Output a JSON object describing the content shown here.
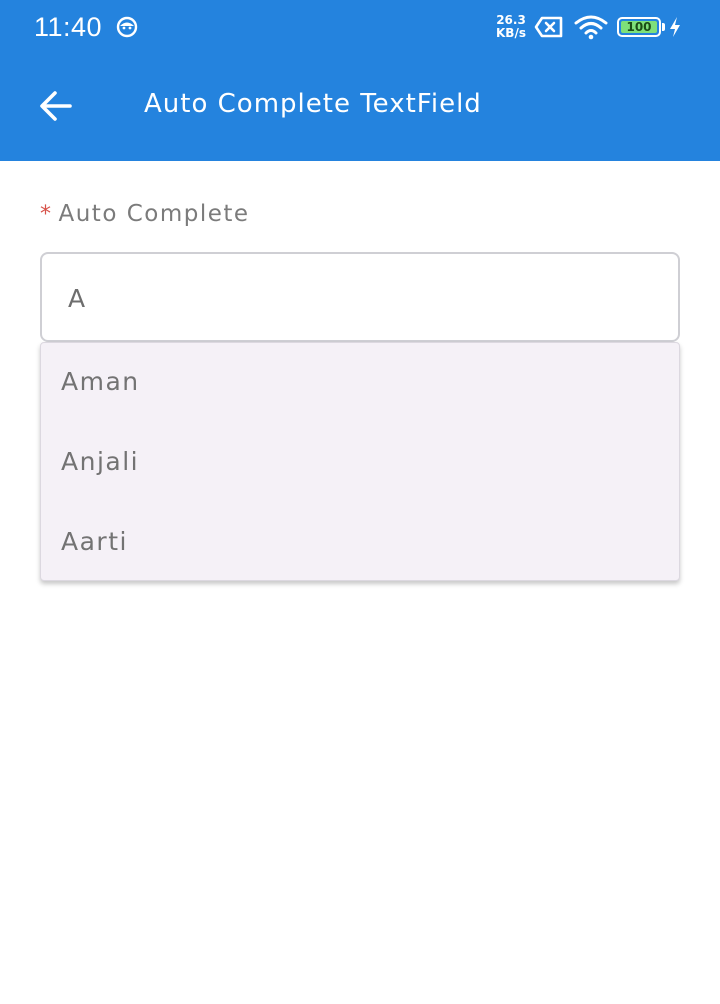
{
  "status_bar": {
    "time": "11:40",
    "net_speed_value": "26.3",
    "net_speed_unit": "KB/s",
    "battery_level": "100"
  },
  "app_bar": {
    "title": "Auto Complete TextField"
  },
  "form": {
    "required_marker": "*",
    "field_label": "Auto Complete",
    "input_value": "A",
    "suggestions": [
      "Aman",
      "Anjali",
      "Aarti"
    ]
  },
  "colors": {
    "app_bar": "#2483de",
    "dropdown_background": "#f5f1f7",
    "required_marker": "#d7524a"
  }
}
